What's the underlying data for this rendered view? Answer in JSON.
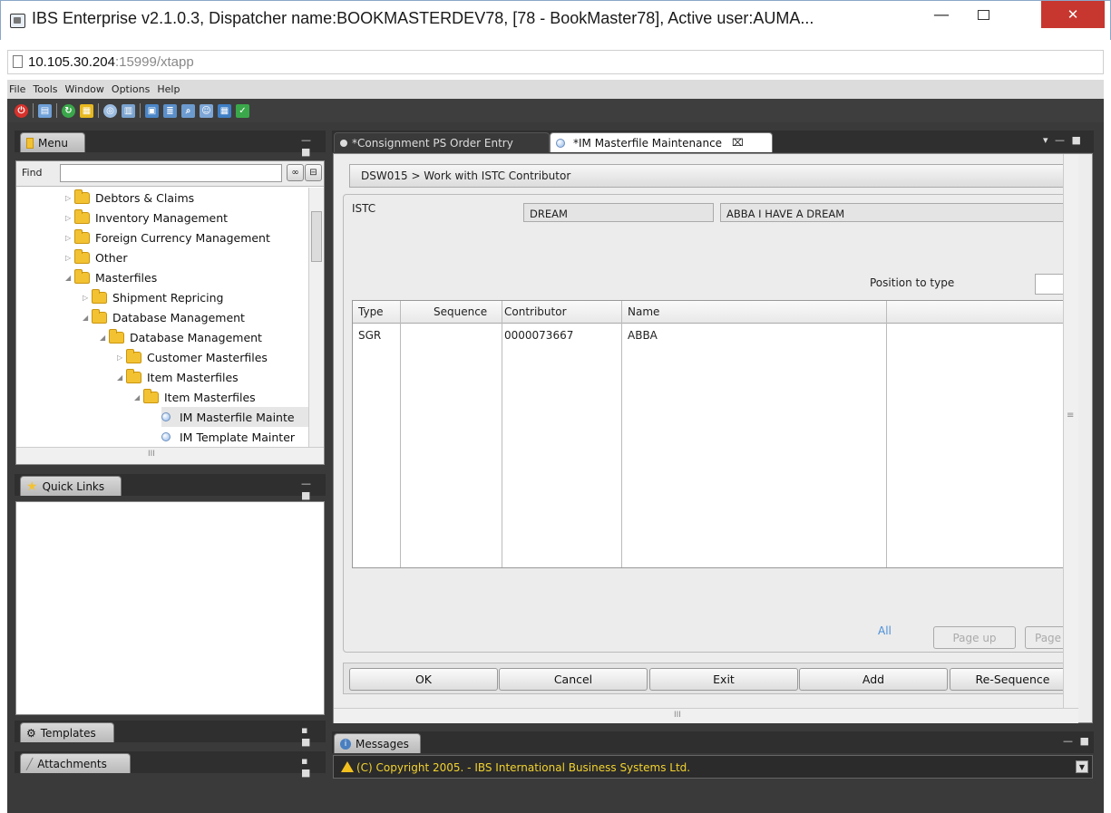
{
  "window": {
    "title": "IBS Enterprise v2.1.0.3, Dispatcher name:BOOKMASTERDEV78, [78 - BookMaster78], Active user:AUMA...",
    "minimize": "—",
    "close": "✕"
  },
  "url": {
    "host": "10.105.30.204",
    "rest": ":15999/xtapp"
  },
  "menubar": [
    "File",
    "Tools",
    "Window",
    "Options",
    "Help"
  ],
  "menu_panel": {
    "tab": "Menu",
    "find_label": "Find",
    "find_value": "",
    "tree": [
      {
        "label": "Debtors & Claims",
        "level": 0,
        "type": "folder"
      },
      {
        "label": "Inventory Management",
        "level": 0,
        "type": "folder"
      },
      {
        "label": "Foreign Currency Management",
        "level": 0,
        "type": "folder"
      },
      {
        "label": "Other",
        "level": 0,
        "type": "folder"
      },
      {
        "label": "Masterfiles",
        "level": 0,
        "type": "folder",
        "expanded": true
      },
      {
        "label": "Shipment Repricing",
        "level": 1,
        "type": "folder"
      },
      {
        "label": "Database Management",
        "level": 1,
        "type": "folder",
        "expanded": true
      },
      {
        "label": "Database Management",
        "level": 2,
        "type": "folder",
        "expanded": true
      },
      {
        "label": "Customer Masterfiles",
        "level": 3,
        "type": "folder"
      },
      {
        "label": "Item Masterfiles",
        "level": 3,
        "type": "folder",
        "expanded": true
      },
      {
        "label": "Item Masterfiles",
        "level": 4,
        "type": "folder",
        "expanded": true
      },
      {
        "label": "IM Masterfile Mainte",
        "level": 5,
        "type": "leaf",
        "selected": true
      },
      {
        "label": "IM Template Mainter",
        "level": 5,
        "type": "leaf"
      }
    ],
    "hscroll_mark": "III"
  },
  "quick_links": {
    "tab": "Quick Links"
  },
  "templates": {
    "tab": "Templates"
  },
  "attachments": {
    "tab": "Attachments"
  },
  "tabs": [
    {
      "label": "*Consignment PS Order Entry",
      "active": false
    },
    {
      "label": "*IM Masterfile Maintenance",
      "active": true
    }
  ],
  "screen": {
    "breadcrumb": "DSW015 > Work with ISTC Contributor",
    "istc_label": "ISTC",
    "istc_code": "DREAM",
    "istc_title": "ABBA I HAVE A DREAM",
    "position_label": "Position to type",
    "position_value": "",
    "columns": [
      "Type",
      "Sequence",
      "Contributor",
      "Name"
    ],
    "rows": [
      {
        "type": "SGR",
        "sequence": "",
        "contributor": "0000073667",
        "name": "ABBA"
      }
    ],
    "all_link": "All",
    "page_up": "Page up",
    "page_down": "Page d",
    "buttons": [
      "OK",
      "Cancel",
      "Exit",
      "Add",
      "Re-Sequence"
    ],
    "hscroll_mark": "III"
  },
  "messages": {
    "tab": "Messages",
    "text": "(C) Copyright 2005. - IBS International Business Systems Ltd."
  },
  "colors": {
    "close_red": "#c7372f",
    "message_yellow": "#f2d22e",
    "link_blue": "#4a8ed8",
    "folder_yellow": "#f3c233"
  }
}
